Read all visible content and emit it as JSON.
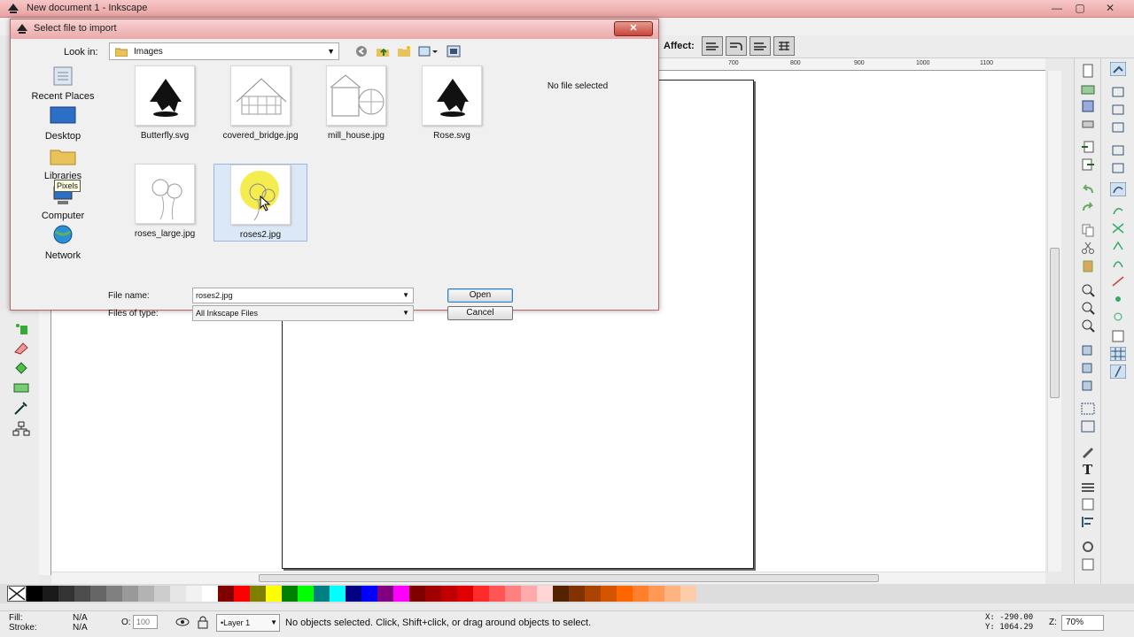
{
  "window": {
    "title": "New document 1 - Inkscape"
  },
  "toolbar": {
    "affect_label": "Affect:"
  },
  "ruler": {
    "ticks": [
      "700",
      "800",
      "900",
      "1000",
      "1100"
    ]
  },
  "dialog": {
    "title": "Select file to import",
    "close_label": "✕",
    "look_in_label": "Look in:",
    "look_in_value": "Images",
    "places": [
      {
        "label": "Recent Places",
        "icon": "recent-places-icon"
      },
      {
        "label": "Desktop",
        "icon": "desktop-icon"
      },
      {
        "label": "Libraries",
        "icon": "libraries-icon"
      },
      {
        "label": "Computer",
        "icon": "computer-icon"
      },
      {
        "label": "Network",
        "icon": "network-icon"
      }
    ],
    "tooltip": "Pixels",
    "files": [
      {
        "name": "Butterfly.svg"
      },
      {
        "name": "covered_bridge.jpg"
      },
      {
        "name": "mill_house.jpg"
      },
      {
        "name": "Rose.svg"
      },
      {
        "name": "roses_large.jpg"
      },
      {
        "name": "roses2.jpg"
      }
    ],
    "preview_text": "No file selected",
    "file_name_label": "File name:",
    "file_name_value": "roses2.jpg",
    "file_type_label": "Files of type:",
    "file_type_value": "All Inkscape Files",
    "open_label": "Open",
    "cancel_label": "Cancel"
  },
  "status": {
    "fill_label": "Fill:",
    "fill_value": "N/A",
    "stroke_label": "Stroke:",
    "stroke_value": "N/A",
    "opacity_label": "O:",
    "opacity_value": "100",
    "layer_value": "•Layer 1",
    "message": "No objects selected. Click, Shift+click, or drag around objects to select.",
    "x_coord": "X: -290.00",
    "y_coord": "Y: 1064.29",
    "zoom_label": "Z:",
    "zoom_value": "70%"
  },
  "palette_colors": [
    "#000000",
    "#1a1a1a",
    "#333333",
    "#4d4d4d",
    "#666666",
    "#808080",
    "#999999",
    "#b3b3b3",
    "#cccccc",
    "#e6e6e6",
    "#f2f2f2",
    "#ffffff",
    "#800000",
    "#ff0000",
    "#808000",
    "#ffff00",
    "#008000",
    "#00ff00",
    "#008080",
    "#00ffff",
    "#000080",
    "#0000ff",
    "#800080",
    "#ff00ff",
    "#800000",
    "#a00000",
    "#c00000",
    "#e00000",
    "#ff2a2a",
    "#ff5555",
    "#ff8080",
    "#ffaaaa",
    "#ffd5d5",
    "#552200",
    "#803300",
    "#aa4400",
    "#d45500",
    "#ff6600",
    "#ff7f2a",
    "#ff9955",
    "#ffb380",
    "#ffccaa"
  ]
}
